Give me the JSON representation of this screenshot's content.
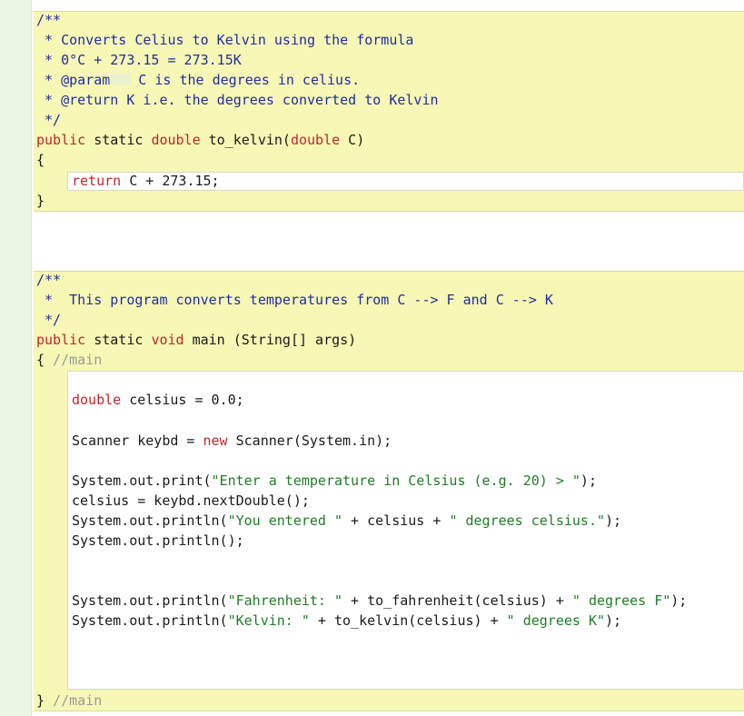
{
  "editor": {
    "method1": {
      "javadoc_open": "/**",
      "doc_line1": " * Converts Celius to Kelvin using the formula",
      "doc_line2": " * 0°C + 273.15 = 273.15K",
      "doc_param_prefix": " * @param",
      "doc_param_rest": " C is the degrees in celius.",
      "doc_return": " * @return K i.e. the degrees converted to Kelvin",
      "javadoc_close": " */",
      "sig_public": "public",
      "sig_static": " static ",
      "sig_type": "double",
      "sig_name": " to_kelvin(",
      "sig_param_type": "double",
      "sig_param_name": " C)",
      "open_brace": "{",
      "body_return_kw": "return",
      "body_return_expr": " C + 273.15;",
      "close_brace": "}"
    },
    "method2": {
      "javadoc_open": "/**",
      "doc_line1": " *  This program converts temperatures from C --> F and C --> K",
      "javadoc_close": " */",
      "sig_public": "public",
      "sig_static": " static ",
      "sig_type": "void",
      "sig_rest": " main (String[] args)",
      "open_brace": "{",
      "open_comment": " //main",
      "decl_type": "double",
      "decl_rest": " celsius = 0.0;",
      "scanner_pre": "Scanner keybd = ",
      "scanner_new": "new",
      "scanner_post": " Scanner(System.in);",
      "print_pre": "System.out.print(",
      "print_str": "\"Enter a temperature in Celsius (e.g. 20) > \"",
      "print_post": ");",
      "read_line": "celsius = keybd.nextDouble();",
      "println1_pre": "System.out.println(",
      "println1_str1": "\"You entered \"",
      "println1_mid": " + celsius + ",
      "println1_str2": "\" degrees celsius.\"",
      "println1_post": ");",
      "println_empty": "System.out.println();",
      "fahr_pre": "System.out.println(",
      "fahr_str1": "\"Fahrenheit: \"",
      "fahr_mid": " + to_fahrenheit(celsius) + ",
      "fahr_str2": "\" degrees F\"",
      "fahr_post": ");",
      "kel_pre": "System.out.println(",
      "kel_str1": "\"Kelvin: \"",
      "kel_mid": " + to_kelvin(celsius) + ",
      "kel_str2": "\" degrees K\"",
      "kel_post": ");",
      "close_brace": "}",
      "close_comment": " //main"
    }
  },
  "colors": {
    "keyword": "#c0262d",
    "doc_comment": "#1f2ea0",
    "line_comment": "#9a9a9a",
    "string": "#1e7d25",
    "block_bg": "#f7f7b6",
    "gutter_bg": "#e8f8e4"
  }
}
